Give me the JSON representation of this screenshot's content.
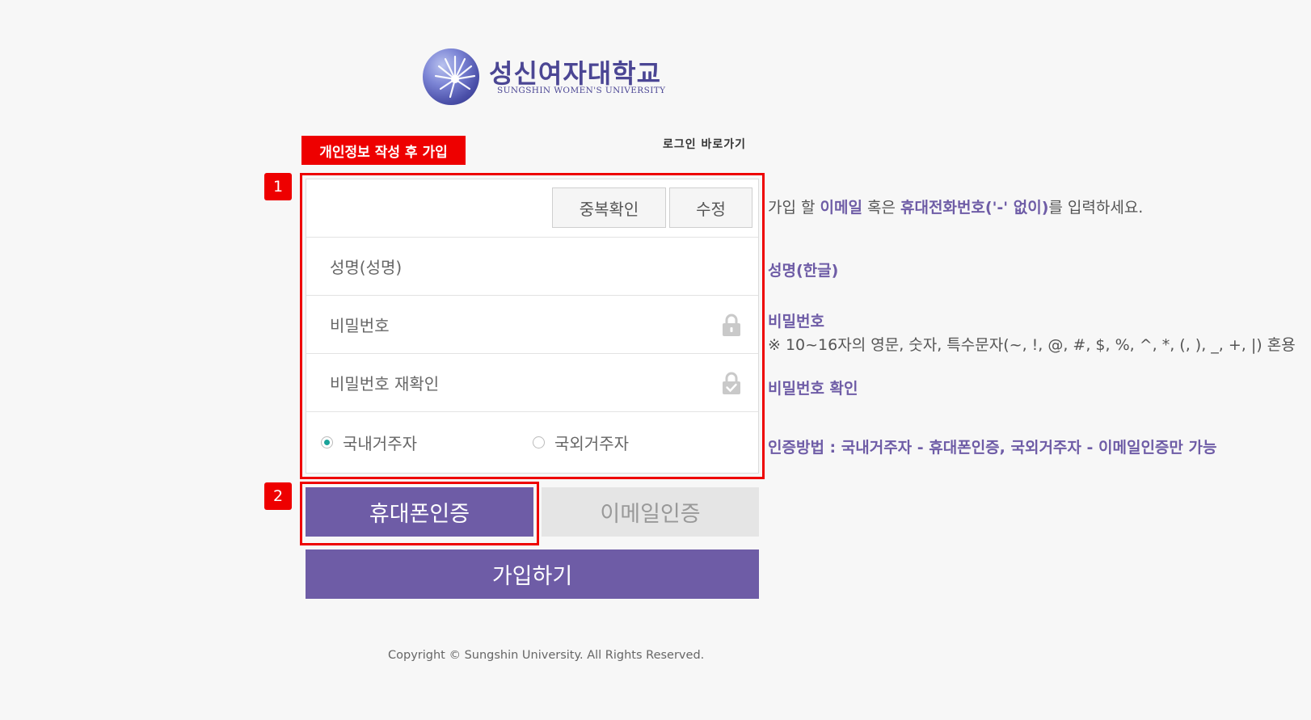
{
  "logo": {
    "name": "성신여자대학교",
    "subtitle": "SUNGSHIN WOMEN'S UNIVERSITY"
  },
  "header": {
    "badge": "개인정보 작성 후 가입",
    "login_link": "로그인 바로가기"
  },
  "markers": {
    "one": "1",
    "two": "2"
  },
  "form": {
    "dup_check_label": "중복확인",
    "edit_label": "수정",
    "name_placeholder": "성명(성명)",
    "password_placeholder": "비밀번호",
    "password_confirm_placeholder": "비밀번호 재확인",
    "residence": {
      "domestic": "국내거주자",
      "abroad": "국외거주자",
      "selected": "국내거주자"
    }
  },
  "buttons": {
    "phone_auth": "휴대폰인증",
    "email_auth": "이메일인증",
    "join": "가입하기"
  },
  "help": {
    "id_pre": "가입 할 ",
    "id_em1": "이메일",
    "id_mid": " 혹은 ",
    "id_em2": "휴대전화번호('-' 없이)",
    "id_post": "를 입력하세요.",
    "name": "성명(한글)",
    "password": "비밀번호",
    "password_rule": "※ 10~16자의 영문, 숫자, 특수문자(~, !, @, #, $, %, ^, *, (, ), _, +, |) 혼용",
    "password_confirm": "비밀번호 확인",
    "auth_method": "인증방법 : 국내거주자 - 휴대폰인증, 국외거주자 - 이메일인증만 가능"
  },
  "footer": {
    "copyright": "Copyright ©  Sungshin University. All Rights Reserved."
  },
  "colors": {
    "accent": "#6e5ca6",
    "highlight_red": "#ee0000",
    "radio_selected": "#1aa39a"
  }
}
